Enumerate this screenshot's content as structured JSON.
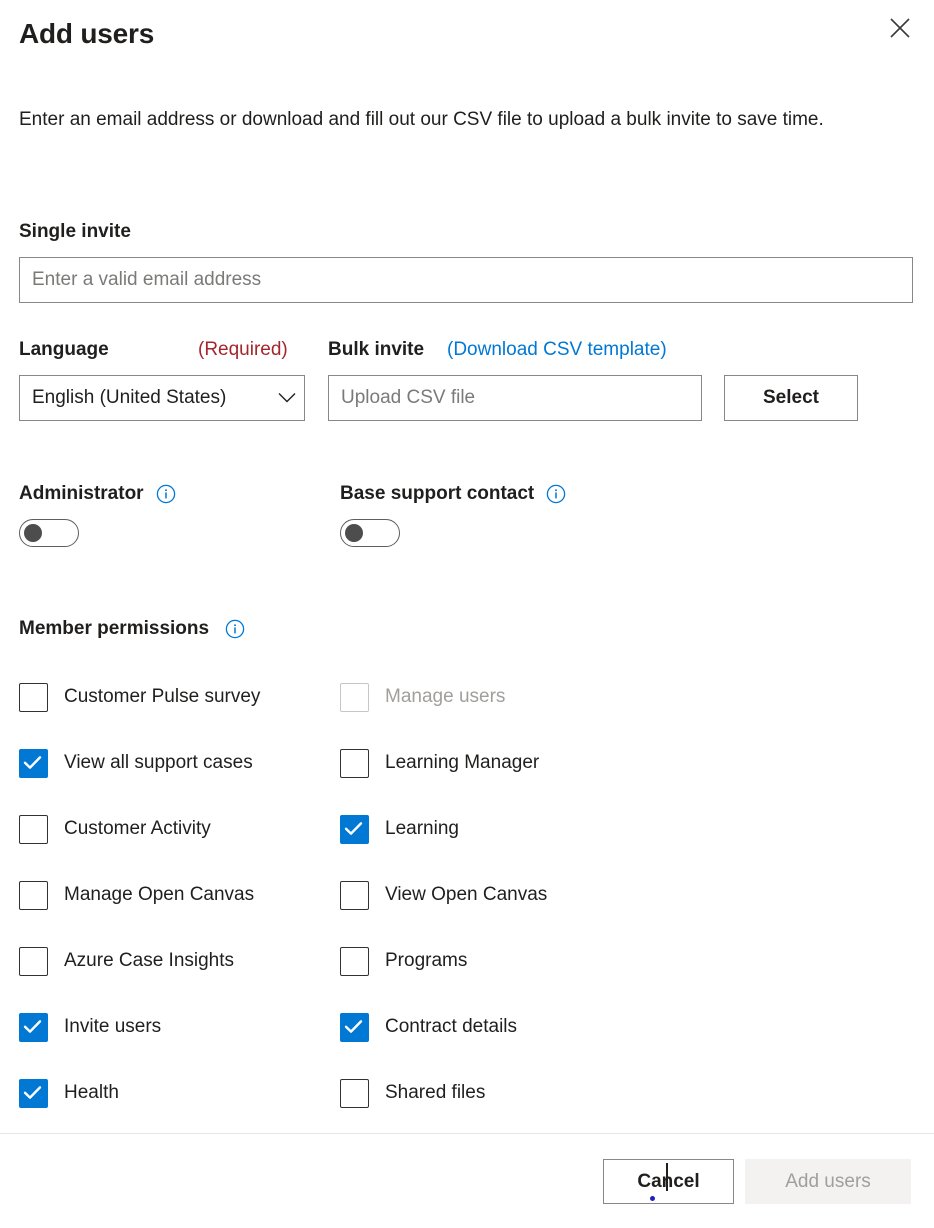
{
  "dialog": {
    "title": "Add users",
    "close_icon": "close-icon",
    "intro": "Enter an email address or download and fill out our CSV file to upload a bulk invite to save time."
  },
  "single_invite": {
    "label": "Single invite",
    "email_placeholder": "Enter a valid email address",
    "email_value": ""
  },
  "language": {
    "label": "Language",
    "required_tag": "(Required)",
    "selected": "English (United States)",
    "chevron_icon": "chevron-down-icon"
  },
  "bulk_invite": {
    "label": "Bulk invite",
    "download_link": "(Download CSV template)",
    "upload_placeholder": "Upload CSV file",
    "upload_value": "",
    "select_label": "Select"
  },
  "toggles": [
    {
      "label": "Administrator",
      "on": false,
      "info_icon": "info-icon"
    },
    {
      "label": "Base support contact",
      "on": false,
      "info_icon": "info-icon"
    }
  ],
  "permissions": {
    "title": "Member permissions",
    "info_icon": "info-icon",
    "left_column": [
      {
        "label": "Customer Pulse survey",
        "checked": false,
        "disabled": false
      },
      {
        "label": "View all support cases",
        "checked": true,
        "disabled": false
      },
      {
        "label": "Customer Activity",
        "checked": false,
        "disabled": false
      },
      {
        "label": "Manage Open Canvas",
        "checked": false,
        "disabled": false
      },
      {
        "label": "Azure Case Insights",
        "checked": false,
        "disabled": false
      },
      {
        "label": "Invite users",
        "checked": true,
        "disabled": false
      },
      {
        "label": "Health",
        "checked": true,
        "disabled": false
      }
    ],
    "right_column": [
      {
        "label": "Manage users",
        "checked": false,
        "disabled": true
      },
      {
        "label": "Learning Manager",
        "checked": false,
        "disabled": false
      },
      {
        "label": "Learning",
        "checked": true,
        "disabled": false
      },
      {
        "label": "View Open Canvas",
        "checked": false,
        "disabled": false
      },
      {
        "label": "Programs",
        "checked": false,
        "disabled": false
      },
      {
        "label": "Contract details",
        "checked": true,
        "disabled": false
      },
      {
        "label": "Shared files",
        "checked": false,
        "disabled": false
      }
    ]
  },
  "footer": {
    "cancel_label": "Cancel",
    "submit_label": "Add users",
    "submit_disabled": true
  },
  "colors": {
    "accent": "#0078d4",
    "required": "#a4262c",
    "text": "#201f1e",
    "disabled_text": "#a19f9d",
    "border": "#8a8886",
    "toggle_knob": "#4d4d4d",
    "disabled_bg": "#f3f2f1"
  }
}
